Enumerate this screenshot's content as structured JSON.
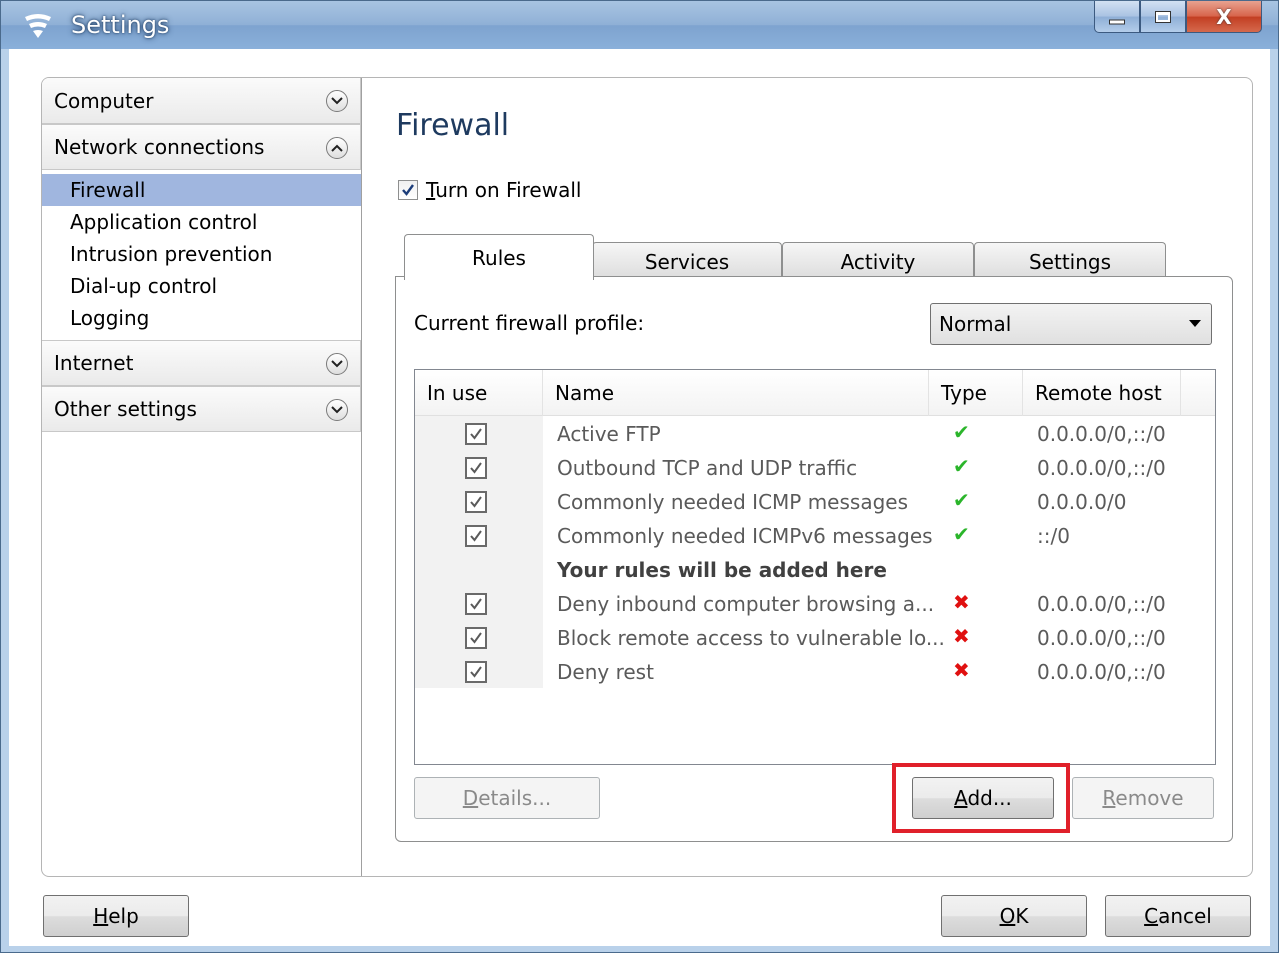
{
  "window": {
    "title": "Settings",
    "close_glyph": "X"
  },
  "sidebar": {
    "sections": [
      {
        "label": "Computer",
        "expanded": false
      },
      {
        "label": "Network connections",
        "expanded": true
      },
      {
        "label": "Internet",
        "expanded": false
      },
      {
        "label": "Other settings",
        "expanded": false
      }
    ],
    "network_items": [
      "Firewall",
      "Application control",
      "Intrusion prevention",
      "Dial-up control",
      "Logging"
    ],
    "selected_item": "Firewall"
  },
  "content": {
    "title": "Firewall",
    "turn_on_label_rest": "urn on Firewall",
    "turn_on_label_accel": "T",
    "turn_on_checked": true,
    "tabs": [
      "Rules",
      "Services",
      "Activity",
      "Settings"
    ],
    "active_tab": "Rules",
    "profile_label": "Current firewall profile:",
    "profile_value": "Normal",
    "columns": [
      "In use",
      "Name",
      "Type",
      "Remote host"
    ],
    "rules": [
      {
        "in_use": true,
        "name": "Active FTP",
        "type": "✔",
        "type_kind": "allow",
        "remote_host": "0.0.0.0/0,::/0"
      },
      {
        "in_use": true,
        "name": "Outbound TCP and UDP traffic",
        "type": "✔",
        "type_kind": "allow",
        "remote_host": "0.0.0.0/0,::/0"
      },
      {
        "in_use": true,
        "name": "Commonly needed ICMP messages",
        "type": "✔",
        "type_kind": "allow",
        "remote_host": "0.0.0.0/0"
      },
      {
        "in_use": true,
        "name": "Commonly needed ICMPv6 messages",
        "type": "✔",
        "type_kind": "allow",
        "remote_host": "::/0"
      },
      {
        "in_use": true,
        "name": "Deny inbound computer browsing a...",
        "type": "✖",
        "type_kind": "deny",
        "remote_host": "0.0.0.0/0,::/0"
      },
      {
        "in_use": true,
        "name": "Block remote access to vulnerable lo...",
        "type": "✖",
        "type_kind": "deny",
        "remote_host": "0.0.0.0/0,::/0"
      },
      {
        "in_use": true,
        "name": "Deny rest",
        "type": "✖",
        "type_kind": "deny",
        "remote_host": "0.0.0.0/0,::/0"
      }
    ],
    "your_rules_note": "Your rules will be added here",
    "buttons": {
      "details_accel": "D",
      "details_rest": "etails...",
      "add_accel": "A",
      "add_rest": "dd...",
      "remove_accel": "R",
      "remove_rest": "emove"
    }
  },
  "footer": {
    "help_accel": "H",
    "help_rest": "elp",
    "ok_accel": "O",
    "ok_rest": "K",
    "cancel_accel": "C",
    "cancel_rest": "ancel"
  },
  "colors": {
    "selected_item_bg": "#a0b6df",
    "allow": "#2bb52b",
    "deny": "#e01010",
    "highlight": "#e0202a"
  }
}
